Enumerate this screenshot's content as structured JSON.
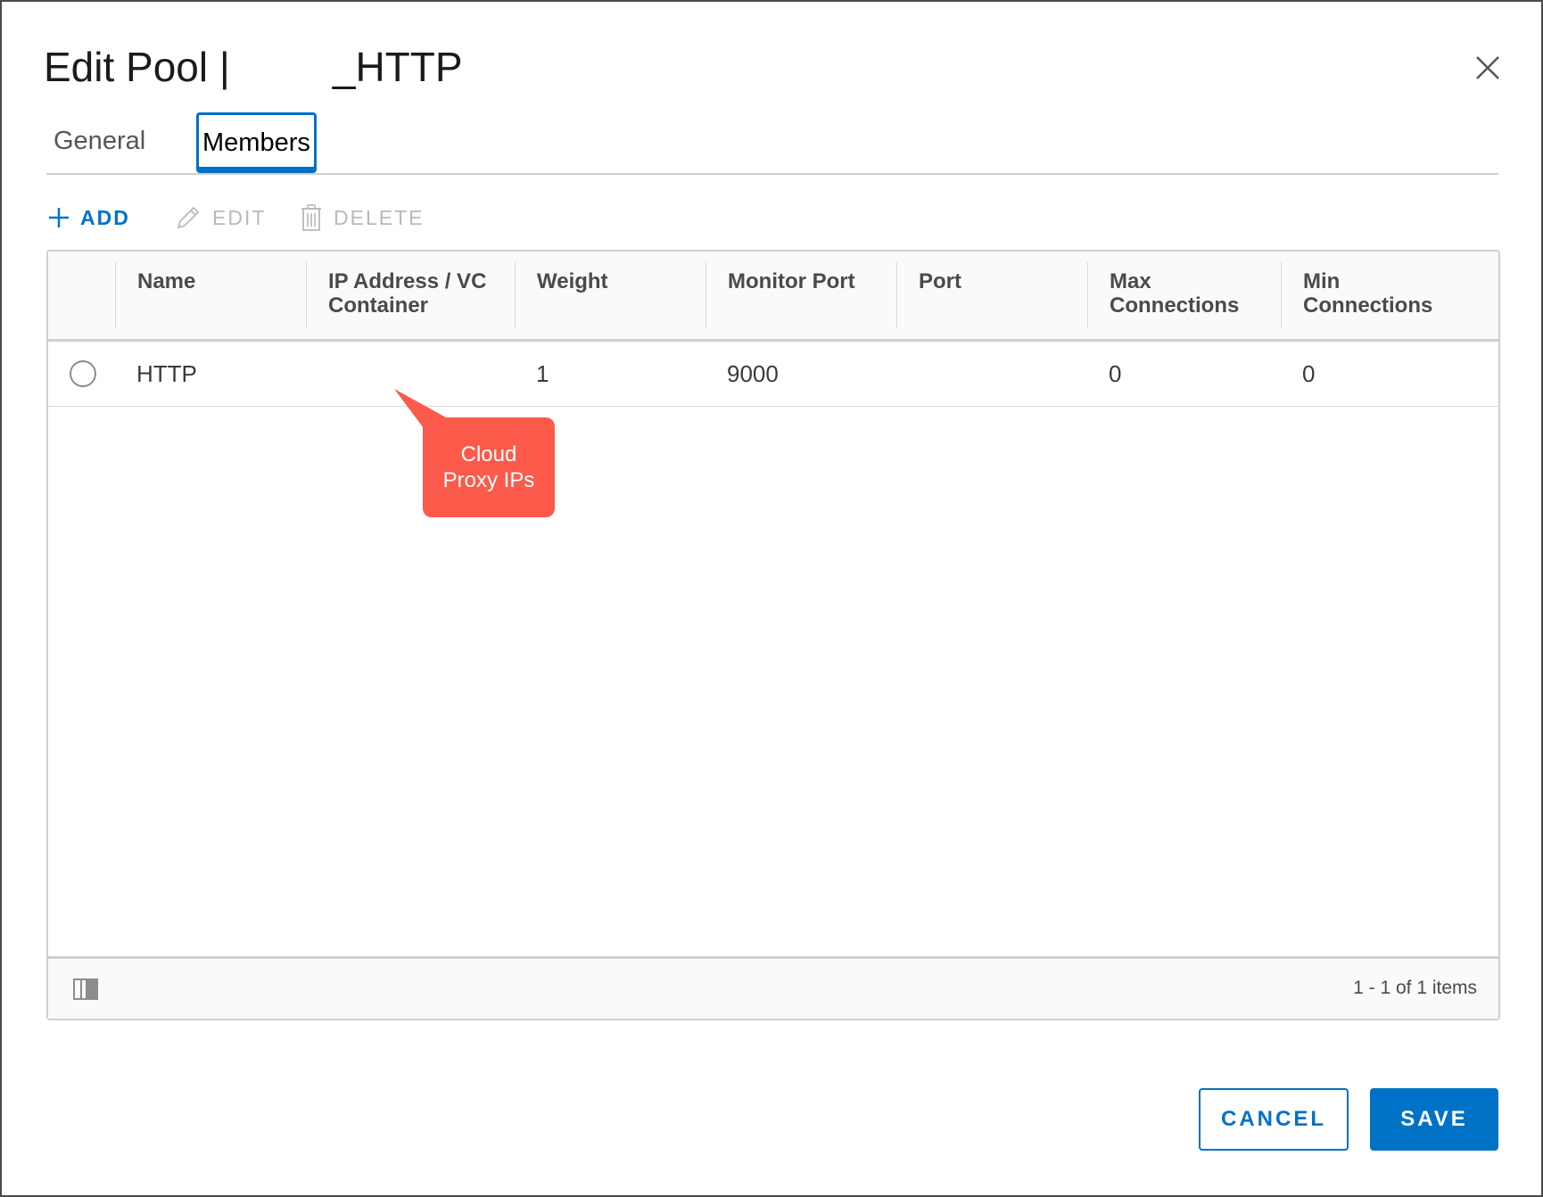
{
  "dialog": {
    "title": "Edit Pool |         _HTTP"
  },
  "tabs": [
    {
      "label": "General",
      "selected": false
    },
    {
      "label": "Members",
      "selected": true
    }
  ],
  "toolbar": {
    "add_label": "ADD",
    "edit_label": "EDIT",
    "delete_label": "DELETE"
  },
  "grid": {
    "columns": [
      {
        "line1": "Name",
        "line2": ""
      },
      {
        "line1": "IP Address / VC",
        "line2": "Container"
      },
      {
        "line1": "Weight",
        "line2": ""
      },
      {
        "line1": "Monitor Port",
        "line2": ""
      },
      {
        "line1": "Port",
        "line2": ""
      },
      {
        "line1": "Max",
        "line2": "Connections"
      },
      {
        "line1": "Min",
        "line2": "Connections"
      }
    ],
    "rows": [
      {
        "name": "HTTP",
        "ip_address": "",
        "weight": "1",
        "monitor_port": "9000",
        "port": "",
        "max_connections": "0",
        "min_connections": "0"
      }
    ],
    "footer": {
      "pagination": "1 - 1 of 1 items"
    }
  },
  "annotation": {
    "line1": "Cloud",
    "line2": "Proxy IPs",
    "color": "#fc5a4b"
  },
  "buttons": {
    "cancel_label": "CANCEL",
    "save_label": "SAVE"
  },
  "colors": {
    "accent": "#0072c6",
    "disabled": "#b9b9b9"
  },
  "icons": {
    "close": "close-icon",
    "add": "plus-icon",
    "edit": "pencil-icon",
    "delete": "trash-icon",
    "column_selector": "column-toggle-icon"
  }
}
